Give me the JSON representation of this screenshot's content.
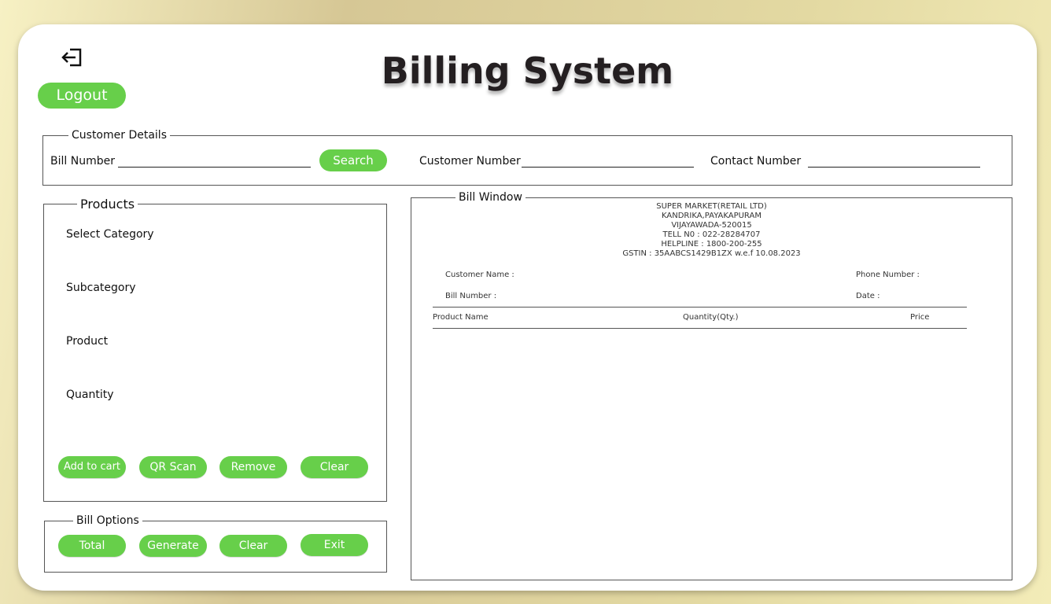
{
  "app": {
    "title": "Billing System",
    "logout_label": "Logout",
    "logout_icon": "logout-icon"
  },
  "customer_details": {
    "legend": "Customer Details",
    "bill_number_label": "Bill Number",
    "bill_number_value": "",
    "search_label": "Search",
    "customer_number_label": "Customer Number",
    "customer_number_value": "",
    "contact_number_label": "Contact Number",
    "contact_number_value": ""
  },
  "products": {
    "legend": "Products",
    "fields": [
      {
        "label": "Select Category"
      },
      {
        "label": "Subcategory"
      },
      {
        "label": "Product"
      },
      {
        "label": "Quantity"
      }
    ],
    "buttons": {
      "add_to_cart": "Add to cart",
      "qr_scan": "QR Scan",
      "remove": "Remove",
      "clear": "Clear"
    }
  },
  "bill_options": {
    "legend": "Bill Options",
    "buttons": {
      "total": "Total",
      "generate": "Generate",
      "clear": "Clear",
      "exit": "Exit"
    }
  },
  "bill_window": {
    "legend": "Bill Window",
    "store_header": [
      "SUPER MARKET(RETAIL LTD)",
      "KANDRIKA,PAYAKAPURAM",
      "VIJAYAWADA-520015",
      "TELL N0 : 022-28284707",
      "HELPLINE : 1800-200-255",
      "GSTIN : 35AABCS1429B1ZX w.e.f 10.08.2023"
    ],
    "customer_name_label": "Customer Name :",
    "phone_number_label": "Phone Number :",
    "bill_number_label": "Bill Number :",
    "date_label": "Date :",
    "columns": [
      "Product Name",
      "Quantity(Qty.)",
      "Price"
    ]
  },
  "colors": {
    "accent": "#67cf4a",
    "title": "#241f21",
    "card": "#ffffff"
  }
}
